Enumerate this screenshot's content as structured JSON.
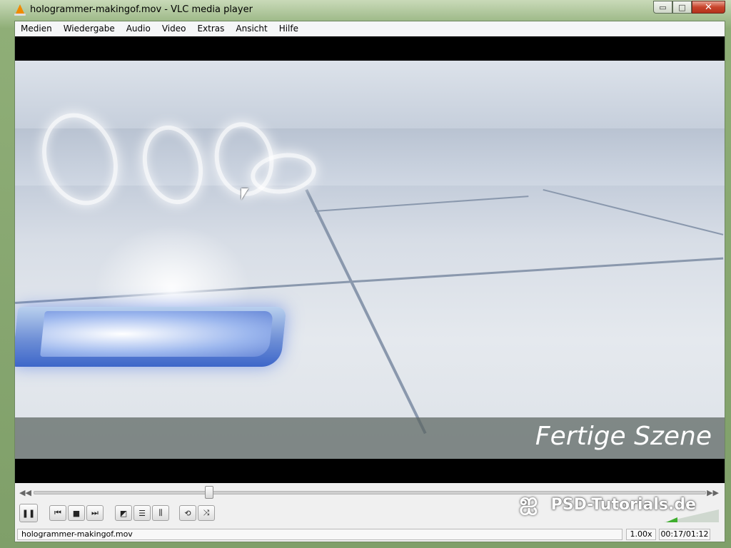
{
  "window": {
    "title": "hologrammer-makingof.mov - VLC media player",
    "minimize_glyph": "▭",
    "maximize_glyph": "□",
    "close_glyph": "✕"
  },
  "menu": {
    "items": [
      "Medien",
      "Wiedergabe",
      "Audio",
      "Video",
      "Extras",
      "Ansicht",
      "Hilfe"
    ]
  },
  "video": {
    "caption": "Fertige Szene"
  },
  "playback": {
    "position_fraction": 0.26,
    "volume_fraction": 0.2
  },
  "controls": {
    "pause_icon": "pause-icon",
    "prev_icon": "skip-previous-icon",
    "stop_icon": "stop-icon",
    "next_icon": "skip-next-icon",
    "fullscreen_icon": "fullscreen-icon",
    "playlist_icon": "playlist-icon",
    "equalizer_icon": "equalizer-icon",
    "loop_icon": "loop-icon",
    "shuffle_icon": "shuffle-icon"
  },
  "watermark": {
    "text": "PSD-Tutorials.de"
  },
  "status": {
    "filename": "hologrammer-makingof.mov",
    "speed": "1.00x",
    "time": "00:17/01:12"
  },
  "colors": {
    "close_button": "#c7442c",
    "volume_level": "#3fae2e"
  }
}
